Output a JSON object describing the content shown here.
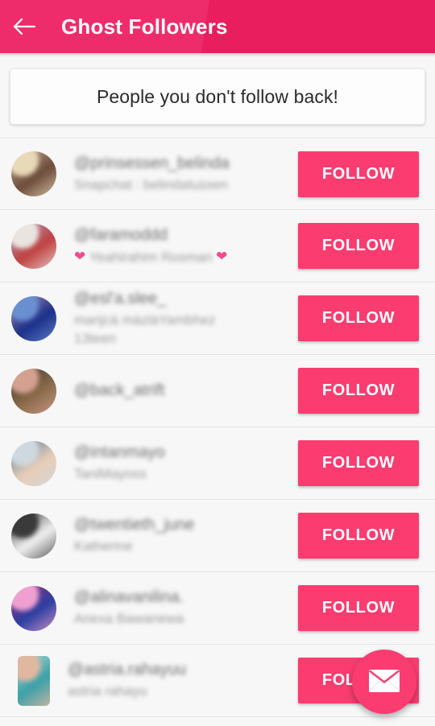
{
  "header": {
    "title": "Ghost Followers",
    "back_icon": "arrow-left-icon",
    "background_color": "#e81e5f"
  },
  "banner": {
    "text": "People you don't follow back!"
  },
  "fab": {
    "icon": "envelope-icon",
    "color": "#fa3c70"
  },
  "list": {
    "follow_label": "FOLLOW",
    "accent_color": "#fa3c70",
    "items": [
      {
        "username": "@prinsessen_belinda",
        "fullname": "Snapchat : belindatussen",
        "extra": "",
        "hearts": false,
        "avatar_style": "circle",
        "avatar_colors": [
          "#d9c9a8",
          "#6b4a3a",
          "#e8d9b8"
        ]
      },
      {
        "username": "@faramoddd",
        "fullname": "Yeahirahim Rosman",
        "extra": "",
        "hearts": true,
        "avatar_style": "circle",
        "avatar_colors": [
          "#9fb8d6",
          "#c04040",
          "#eae4e0"
        ]
      },
      {
        "username": "@esl'a.slee_",
        "fullname": "marijcà màzlàYambhez",
        "extra": "13teen",
        "hearts": false,
        "avatar_style": "circle",
        "avatar_colors": [
          "#c9a9b8",
          "#1b2f8a",
          "#6a8fd0"
        ]
      },
      {
        "username": "@back_atrift",
        "fullname": "",
        "extra": "",
        "hearts": false,
        "avatar_style": "circle",
        "avatar_colors": [
          "#2a2a22",
          "#8a6a4a",
          "#d4a090"
        ]
      },
      {
        "username": "@intanmayo",
        "fullname": "TaniMayoss",
        "extra": "",
        "hearts": false,
        "avatar_style": "circle",
        "avatar_colors": [
          "#2d6a8f",
          "#e8cdb8",
          "#cfd8df"
        ]
      },
      {
        "username": "@twentieth_june",
        "fullname": "Katherine",
        "extra": "",
        "hearts": false,
        "avatar_style": "circle",
        "avatar_colors": [
          "#111111",
          "#f2f2f2",
          "#3a3a3a"
        ]
      },
      {
        "username": "@alinavanilina.",
        "fullname": "Anexa Bawanewa",
        "extra": "",
        "hearts": false,
        "avatar_style": "circle",
        "avatar_colors": [
          "#c02a7a",
          "#2a3fa0",
          "#f0a0d0"
        ]
      },
      {
        "username": "@astria.rahayuu",
        "fullname": "astria rahayu",
        "extra": "",
        "hearts": false,
        "avatar_style": "tall",
        "avatar_colors": [
          "#cfe8e0",
          "#3aa0a8",
          "#e0b8a0"
        ]
      }
    ]
  }
}
